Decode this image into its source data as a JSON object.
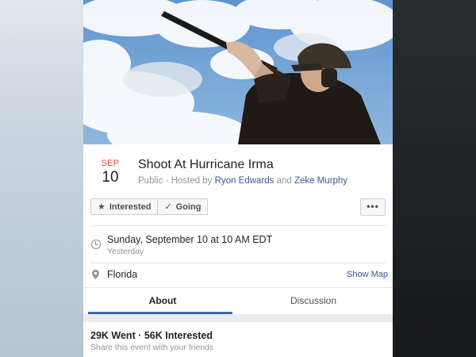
{
  "event": {
    "date": {
      "month": "SEP",
      "day": "10"
    },
    "title": "Shoot At Hurricane Irma",
    "privacy": "Public",
    "hosted_by_prefix": "Hosted by",
    "hosts": [
      "Ryon Edwards",
      "Zeke Murphy"
    ],
    "host_conjunction": "and",
    "separator": "·"
  },
  "actions": {
    "interested_label": "Interested",
    "going_label": "Going",
    "more_label": "•••"
  },
  "details": {
    "time": "Sunday, September 10 at 10 AM EDT",
    "time_relative": "Yesterday",
    "location": "Florida",
    "show_map": "Show Map"
  },
  "tabs": [
    {
      "label": "About",
      "active": true
    },
    {
      "label": "Discussion",
      "active": false
    }
  ],
  "stats": {
    "summary": "29K Went · 56K Interested",
    "share_prompt": "Share this event with your friends"
  },
  "colors": {
    "date_month": "#e04b3f",
    "link": "#365899",
    "tab_indicator": "#4267b2"
  },
  "icons": {
    "interested": "star-icon",
    "going": "checkmark-icon",
    "time": "clock-icon",
    "location": "map-pin-icon",
    "more": "more-dots-icon"
  }
}
